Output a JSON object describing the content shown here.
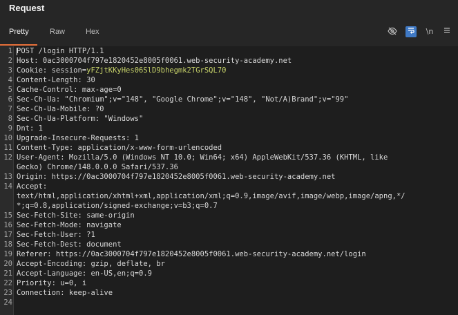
{
  "panel": {
    "title": "Request"
  },
  "tabs": [
    {
      "label": "Pretty",
      "active": true
    },
    {
      "label": "Raw",
      "active": false
    },
    {
      "label": "Hex",
      "active": false
    }
  ],
  "toolbar": {
    "hide_icon": "eye-slash-icon",
    "wrap_icon": "wrap-lines-icon",
    "newline_label": "\\n",
    "menu_icon": "hamburger-menu-icon"
  },
  "colors": {
    "accent": "#e8703a",
    "cookie_value": "#c8d46a",
    "wrap_button": "#3f79c5"
  },
  "lines": [
    {
      "n": "1",
      "text": "POST /login HTTP/1.1"
    },
    {
      "n": "2",
      "text": "Host: 0ac3000704f797e1820452e8005f0061.web-security-academy.net"
    },
    {
      "n": "3",
      "key": "Cookie: session=",
      "value": "yFZjtKKyHes06SlD9bhegmk2TGrSQL70"
    },
    {
      "n": "4",
      "text": "Content-Length: 30"
    },
    {
      "n": "5",
      "text": "Cache-Control: max-age=0"
    },
    {
      "n": "6",
      "text": "Sec-Ch-Ua: \"Chromium\";v=\"148\", \"Google Chrome\";v=\"148\", \"Not/A)Brand\";v=\"99\""
    },
    {
      "n": "7",
      "text": "Sec-Ch-Ua-Mobile: ?0"
    },
    {
      "n": "8",
      "text": "Sec-Ch-Ua-Platform: \"Windows\""
    },
    {
      "n": "9",
      "text": "Dnt: 1"
    },
    {
      "n": "10",
      "text": "Upgrade-Insecure-Requests: 1"
    },
    {
      "n": "11",
      "text": "Content-Type: application/x-www-form-urlencoded"
    },
    {
      "n": "12",
      "text": "User-Agent: Mozilla/5.0 (Windows NT 10.0; Win64; x64) AppleWebKit/537.36 (KHTML, like"
    },
    {
      "n": "",
      "text": "Gecko) Chrome/148.0.0.0 Safari/537.36"
    },
    {
      "n": "13",
      "text": "Origin: https://0ac3000704f797e1820452e8005f0061.web-security-academy.net"
    },
    {
      "n": "14",
      "text": "Accept:"
    },
    {
      "n": "",
      "text": "text/html,application/xhtml+xml,application/xml;q=0.9,image/avif,image/webp,image/apng,*/"
    },
    {
      "n": "",
      "text": "*;q=0.8,application/signed-exchange;v=b3;q=0.7"
    },
    {
      "n": "15",
      "text": "Sec-Fetch-Site: same-origin"
    },
    {
      "n": "16",
      "text": "Sec-Fetch-Mode: navigate"
    },
    {
      "n": "17",
      "text": "Sec-Fetch-User: ?1"
    },
    {
      "n": "18",
      "text": "Sec-Fetch-Dest: document"
    },
    {
      "n": "19",
      "text": "Referer: https://0ac3000704f797e1820452e8005f0061.web-security-academy.net/login"
    },
    {
      "n": "20",
      "text": "Accept-Encoding: gzip, deflate, br"
    },
    {
      "n": "21",
      "text": "Accept-Language: en-US,en;q=0.9"
    },
    {
      "n": "22",
      "text": "Priority: u=0, i"
    },
    {
      "n": "23",
      "text": "Connection: keep-alive"
    },
    {
      "n": "24",
      "text": ""
    }
  ]
}
